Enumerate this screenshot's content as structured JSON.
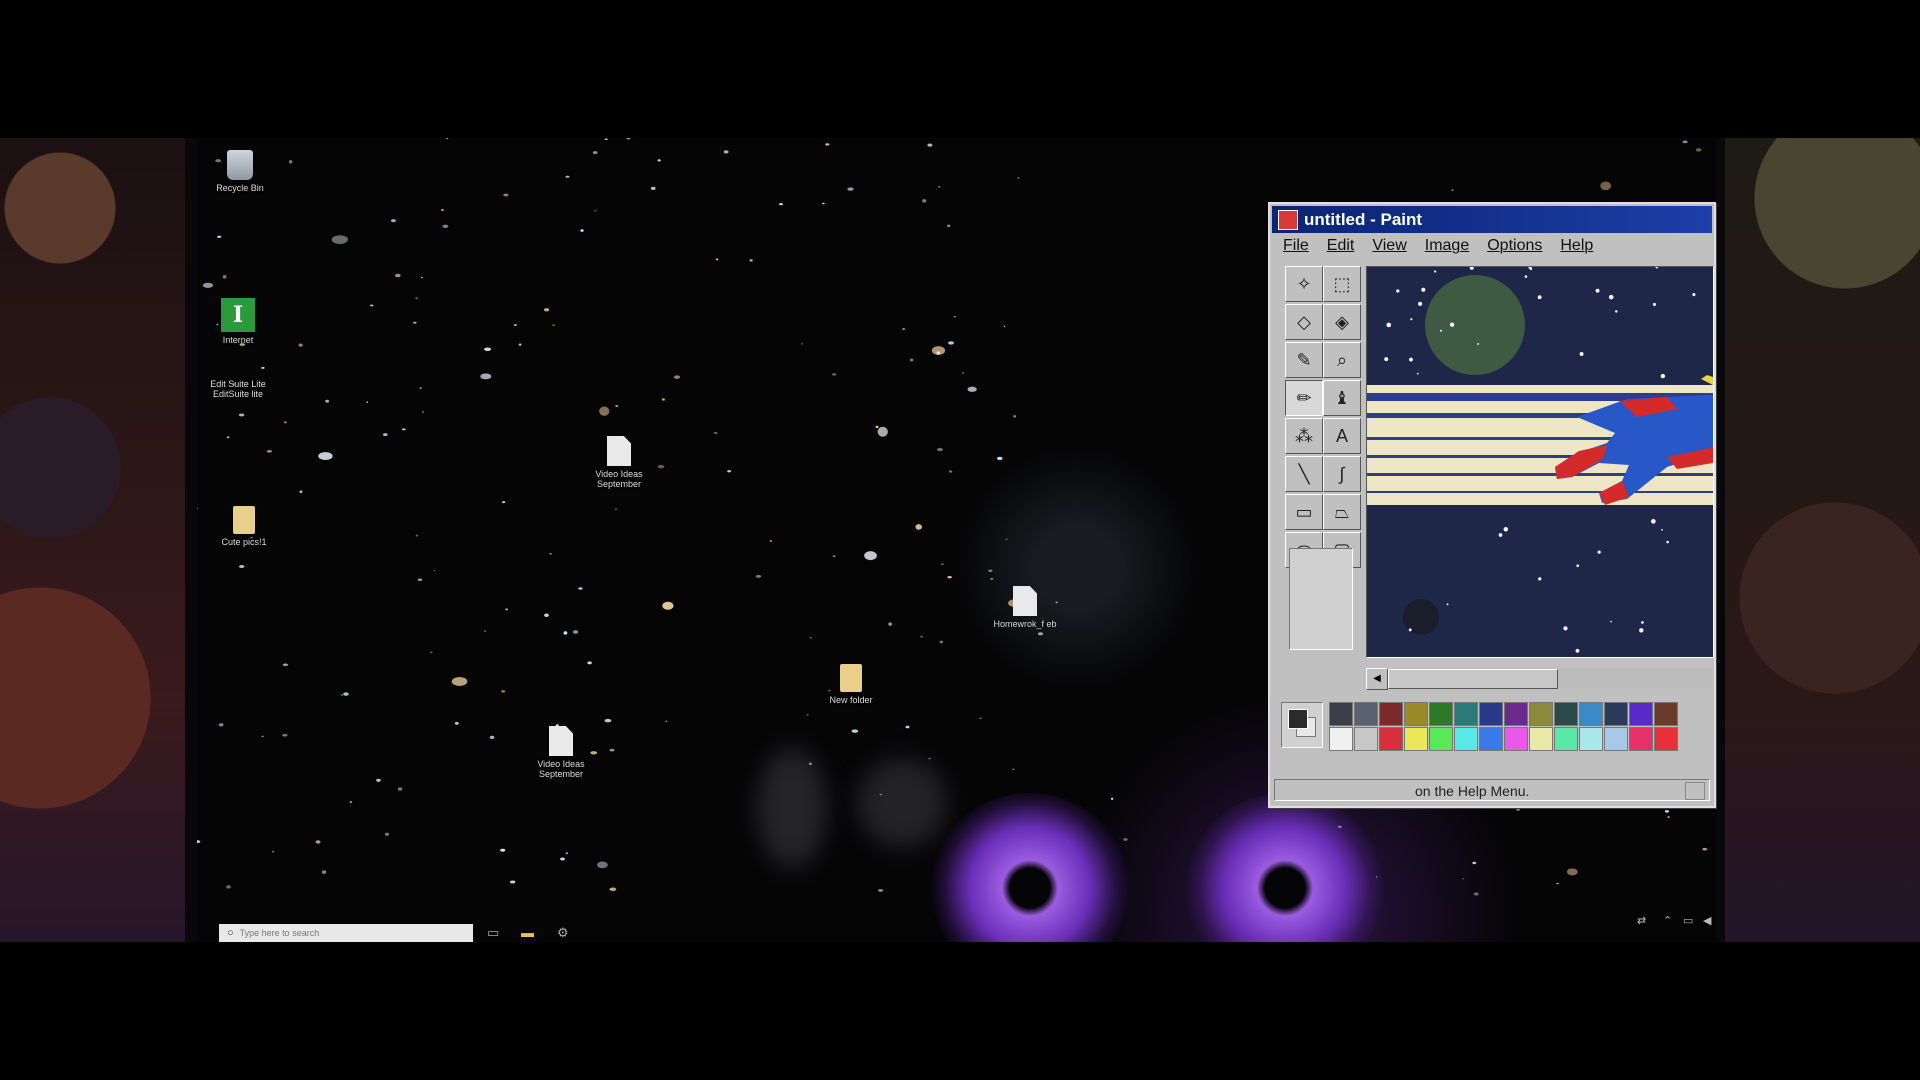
{
  "desktop": {
    "icons": [
      {
        "id": "recycle-bin",
        "label": "Recycle Bin",
        "type": "bin"
      },
      {
        "id": "internet",
        "label": "Internet",
        "type": "app",
        "glyph": "I"
      },
      {
        "id": "editsuite",
        "label": "Edit Suite Lite\nEditSuite lite",
        "type": "small"
      },
      {
        "id": "cute-pics",
        "label": "Cute pics!1",
        "type": "folder"
      },
      {
        "id": "video-ideas-1",
        "label": "Video Ideas September",
        "type": "file"
      },
      {
        "id": "homework",
        "label": "Homewrok_f eb",
        "type": "file"
      },
      {
        "id": "new-folder",
        "label": "New folder",
        "type": "folder"
      },
      {
        "id": "video-ideas-2",
        "label": "Video Ideas September",
        "type": "file"
      }
    ]
  },
  "taskbar": {
    "search_placeholder": "Type here to search",
    "search_icon": "search-icon",
    "task_view_icon": "task-view-icon",
    "file_explorer_icon": "folder-icon",
    "settings_icon": "gear-icon",
    "tray": [
      "network-icon",
      "chevron-up-icon",
      "display-icon",
      "speaker-icon"
    ]
  },
  "paint": {
    "title": "untitled - Paint",
    "menus": [
      "File",
      "Edit",
      "View",
      "Image",
      "Options",
      "Help"
    ],
    "status_text": "on the Help Menu.",
    "tools": [
      "free-select-icon",
      "rect-select-icon",
      "eraser-icon",
      "fill-icon",
      "color-picker-icon",
      "magnifier-icon",
      "pencil-icon",
      "brush-icon",
      "airbrush-icon",
      "text-icon",
      "line-icon",
      "curve-icon",
      "rectangle-icon",
      "polygon-icon",
      "ellipse-icon",
      "rounded-rect-icon"
    ],
    "active_tool": "pencil-icon",
    "palette_top": [
      "#3a3f4a",
      "#5a6270",
      "#7a2a2a",
      "#9a8a2a",
      "#2a7a2a",
      "#2a7a7a",
      "#2a3a8a",
      "#6a2a8a",
      "#8a8a3a",
      "#2a4a4a",
      "#3a8ac8",
      "#2a3a5a",
      "#5a2ac8",
      "#6a3a2a"
    ],
    "palette_bottom": [
      "#f0f0f0",
      "#c8c8c8",
      "#d8303a",
      "#e8e858",
      "#58e858",
      "#58e8e8",
      "#3a7ae8",
      "#e858e8",
      "#e8e8a8",
      "#58e8a8",
      "#a8e8e8",
      "#a8c8e8",
      "#e8306a",
      "#e8303a"
    ],
    "foreground_color": "#2b2b2b",
    "background_color": "#e8e8e8"
  }
}
